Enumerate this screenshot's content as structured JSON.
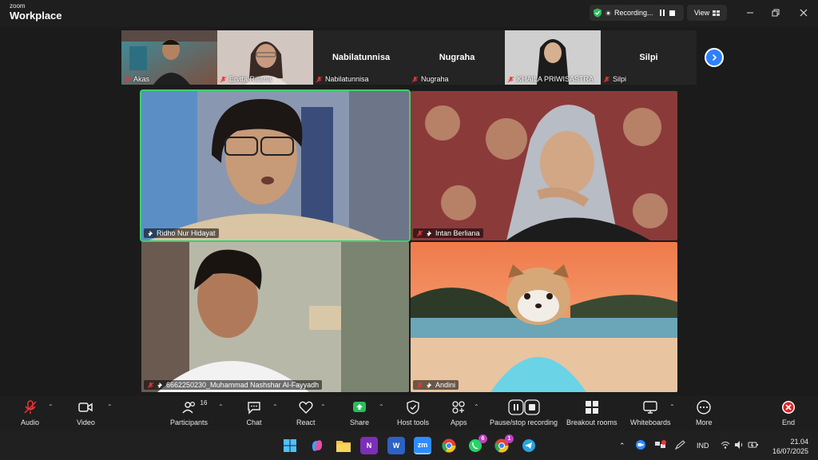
{
  "app": {
    "brand_line1": "zoom",
    "brand_line2": "Workplace",
    "recording_label": "Recording...",
    "view_label": "View"
  },
  "strip": [
    {
      "name": "Akas",
      "has_video": true
    },
    {
      "name": "Ervita Riliana",
      "has_video": true
    },
    {
      "name": "Nabilatunnisa",
      "big_name": "Nabilatunnisa",
      "has_video": false
    },
    {
      "name": "Nugraha",
      "big_name": "Nugraha",
      "has_video": false
    },
    {
      "name": "KHAILA PRIWISASTRA",
      "has_video": true
    },
    {
      "name": "Silpi",
      "big_name": "Silpi",
      "has_video": false
    }
  ],
  "tiles": [
    {
      "name": "Ridho Nur Hidayat",
      "active": true
    },
    {
      "name": "Intan Berliana",
      "active": false
    },
    {
      "name": "6662250230_Muhammad Nashshar Al-Fayyadh",
      "active": false
    },
    {
      "name": "Andini",
      "active": false
    }
  ],
  "toolbar": {
    "audio": "Audio",
    "video": "Video",
    "participants": "Participants",
    "participants_count": "16",
    "chat": "Chat",
    "react": "React",
    "share": "Share",
    "host_tools": "Host tools",
    "apps": "Apps",
    "pause_stop": "Pause/stop recording",
    "breakout": "Breakout rooms",
    "whiteboards": "Whiteboards",
    "more": "More",
    "end": "End"
  },
  "taskbar": {
    "word_letter": "W",
    "onenote_letter": "N",
    "zoom_letter": "zm",
    "whatsapp_badge": "6",
    "chrome_badge": "1",
    "lang": "IND",
    "time": "21.04",
    "date": "16/07/2025"
  },
  "colors": {
    "accent": "#2f80ff",
    "active_speaker": "#3ad06c",
    "end_red": "#e02020",
    "share_green": "#2bbd5a"
  }
}
